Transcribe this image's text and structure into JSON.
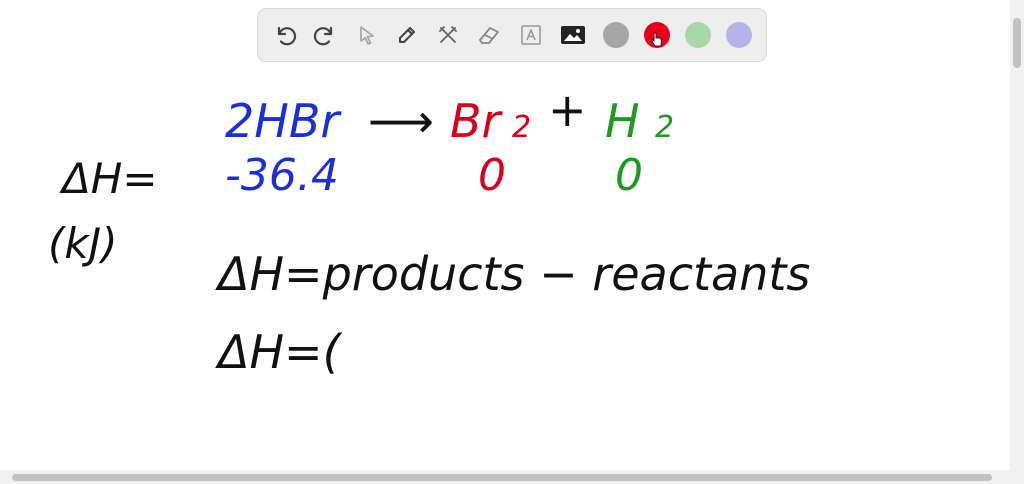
{
  "toolbar": {
    "tools": [
      {
        "name": "undo-icon"
      },
      {
        "name": "redo-icon"
      },
      {
        "name": "select-pointer-icon"
      },
      {
        "name": "pen-icon"
      },
      {
        "name": "tools-icon"
      },
      {
        "name": "eraser-icon"
      },
      {
        "name": "text-icon"
      },
      {
        "name": "image-icon"
      }
    ],
    "colors": {
      "gray": "#a6a6a6",
      "red": "#e8001c",
      "green": "#a8d8a8",
      "lavender": "#b4b4ea"
    },
    "selected_color": "red"
  },
  "board": {
    "ink_colors": {
      "black": "#111111",
      "blue": "#1a2fd6",
      "red": "#d9001b",
      "green": "#1f9a1f"
    },
    "lines": {
      "dh_label": "ΔH=",
      "units": "(kJ)",
      "reactant": "2HBr",
      "arrow": "⟶",
      "product1": "Br",
      "product1_sub": "2",
      "plus": "+",
      "product2": "H",
      "product2_sub": "2",
      "reactant_value": "-36.4",
      "product1_value": "0",
      "product2_value": "0",
      "formula": "ΔH=products − reactants",
      "formula2": "ΔH=("
    }
  }
}
